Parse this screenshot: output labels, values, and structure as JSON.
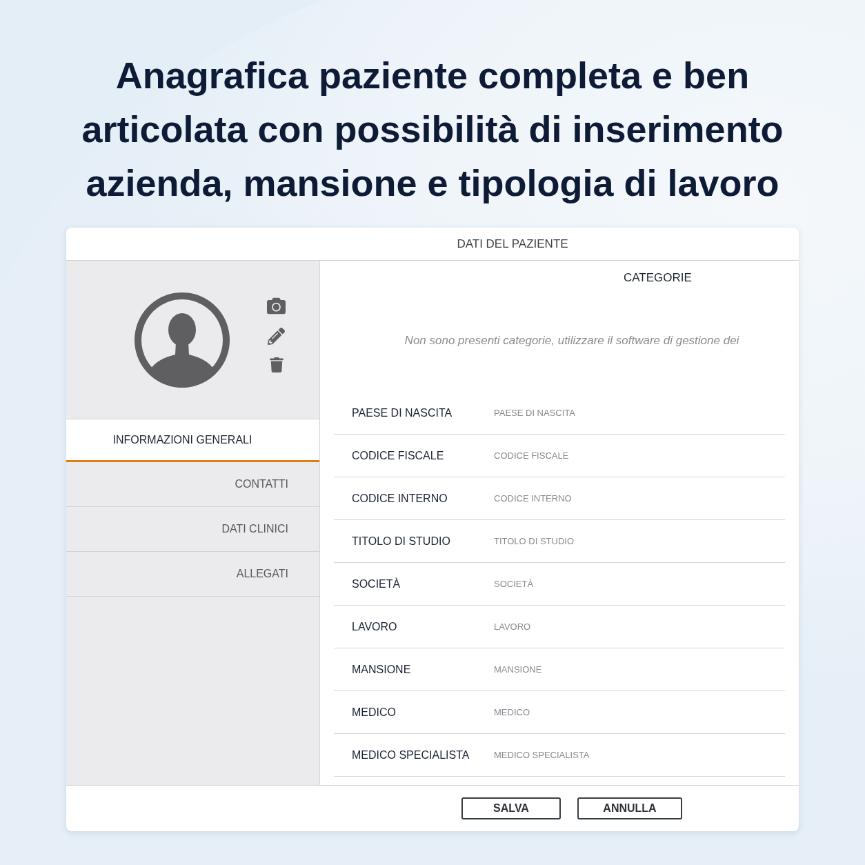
{
  "headline": "Anagrafica paziente completa e ben\narticolata con possibilità di inserimento\nazienda, mansione e tipologia di lavoro",
  "dialog": {
    "title": "DATI DEL PAZIENTE",
    "tabs": [
      {
        "label": "INFORMAZIONI GENERALI",
        "selected": true
      },
      {
        "label": "CONTATTI",
        "selected": false
      },
      {
        "label": "DATI CLINICI",
        "selected": false
      },
      {
        "label": "ALLEGATI",
        "selected": false
      }
    ],
    "categories": {
      "title": "CATEGORIE",
      "empty_message": "Non sono presenti categorie, utilizzare il software di gestione dei"
    },
    "fields": [
      {
        "label": "PAESE DI NASCITA",
        "placeholder": "PAESE DI NASCITA"
      },
      {
        "label": "CODICE FISCALE",
        "placeholder": "CODICE FISCALE"
      },
      {
        "label": "CODICE INTERNO",
        "placeholder": "CODICE INTERNO"
      },
      {
        "label": "TITOLO DI STUDIO",
        "placeholder": "TITOLO DI STUDIO"
      },
      {
        "label": "SOCIETÀ",
        "placeholder": "SOCIETÀ"
      },
      {
        "label": "LAVORO",
        "placeholder": "LAVORO"
      },
      {
        "label": "MANSIONE",
        "placeholder": "MANSIONE"
      },
      {
        "label": "MEDICO",
        "placeholder": "MEDICO"
      },
      {
        "label": "MEDICO SPECIALISTA",
        "placeholder": "MEDICO SPECIALISTA"
      }
    ],
    "buttons": [
      "SALVA",
      "ANNULLA"
    ]
  }
}
